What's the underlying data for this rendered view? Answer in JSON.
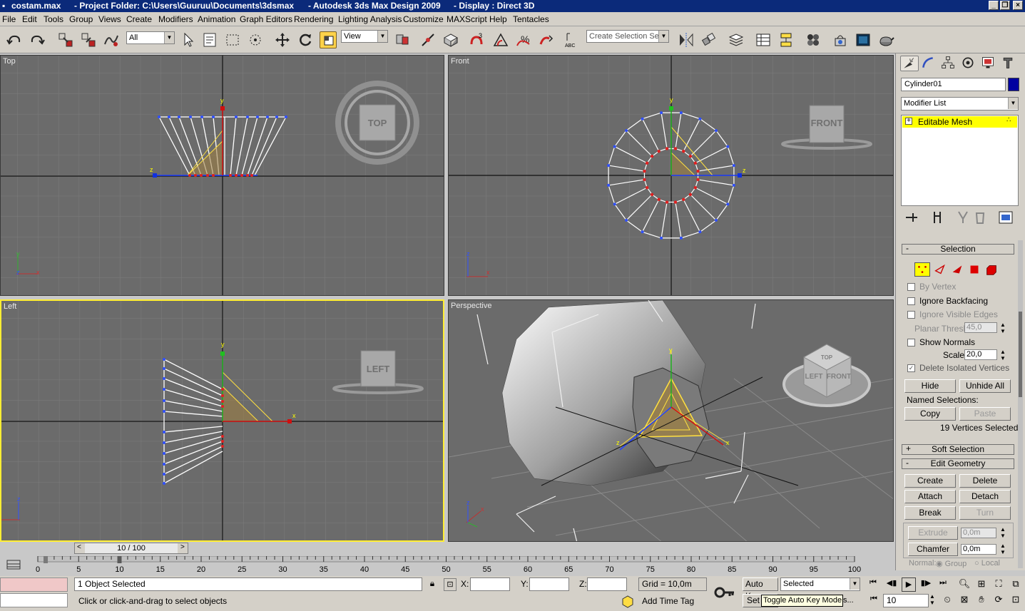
{
  "window": {
    "file": "costam.max",
    "project": "- Project Folder: C:\\Users\\Guuruu\\Documents\\3dsmax",
    "app": "- Autodesk 3ds Max Design 2009",
    "display": "- Display : Direct 3D"
  },
  "menu": [
    "File",
    "Edit",
    "Tools",
    "Group",
    "Views",
    "Create",
    "Modifiers",
    "Animation",
    "Graph Editors",
    "Rendering",
    "Lighting Analysis",
    "Customize",
    "MAXScript",
    "Help",
    "Tentacles"
  ],
  "toolbar": {
    "filter": "All",
    "refcoord": "View",
    "selection_set": "Create Selection Set"
  },
  "viewports": {
    "top": "Top",
    "front": "Front",
    "left": "Left",
    "perspective": "Perspective",
    "cube_top": "TOP",
    "cube_front": "FRONT",
    "cube_left": "LEFT",
    "persp_cube_top": "TOP",
    "persp_cube_left": "LEFT",
    "persp_cube_front": "FRONT"
  },
  "axes": {
    "x": "x",
    "y": "y",
    "z": "z"
  },
  "command_panel": {
    "object_name": "Cylinder01",
    "object_color": "#0000a0",
    "modifier_list": "Modifier List",
    "stack_item": "Editable Mesh",
    "selection_rollout": "Selection",
    "by_vertex": "By Vertex",
    "ignore_backfacing": "Ignore Backfacing",
    "ignore_visible_edges": "Ignore Visible Edges",
    "planar_thresh_label": "Planar Thresh:",
    "planar_thresh": "45,0",
    "show_normals": "Show Normals",
    "scale_label": "Scale:",
    "scale": "20,0",
    "delete_isolated": "Delete Isolated Vertices",
    "hide": "Hide",
    "unhide_all": "Unhide All",
    "named_selections": "Named Selections:",
    "copy": "Copy",
    "paste": "Paste",
    "selected_count": "19 Vertices Selected",
    "soft_selection": "Soft Selection",
    "edit_geometry": "Edit Geometry",
    "create": "Create",
    "delete": "Delete",
    "attach": "Attach",
    "detach": "Detach",
    "break": "Break",
    "turn": "Turn",
    "extrude": "Extrude",
    "extrude_val": "0,0m",
    "chamfer": "Chamfer",
    "chamfer_val": "0,0m",
    "normal_label": "Normal:",
    "group": "Group",
    "local": "Local"
  },
  "timeline": {
    "frame": "10 / 100",
    "ticks": [
      "0",
      "5",
      "10",
      "15",
      "20",
      "25",
      "30",
      "35",
      "40",
      "45",
      "50",
      "55",
      "60",
      "65",
      "70",
      "75",
      "80",
      "85",
      "90",
      "95",
      "100"
    ]
  },
  "status": {
    "objects_selected": "1 Object Selected",
    "prompt": "Click or click-and-drag to select objects",
    "x_label": "X:",
    "y_label": "Y:",
    "z_label": "Z:",
    "grid": "Grid = 10,0m",
    "auto_key": "Auto Key",
    "key_mode": "Selected",
    "set_key": "Set",
    "tooltip": "Toggle Auto Key Mode",
    "add_time_tag": "Add Time Tag",
    "frame_field": "10",
    "dots": "s..."
  },
  "colors": {
    "viewport_bg": "#6b6b6b",
    "grid": "#7c7c7c",
    "active_border": "#ffee33",
    "selected_vertex": "#d01010",
    "highlight_yellow": "#ffff00"
  }
}
